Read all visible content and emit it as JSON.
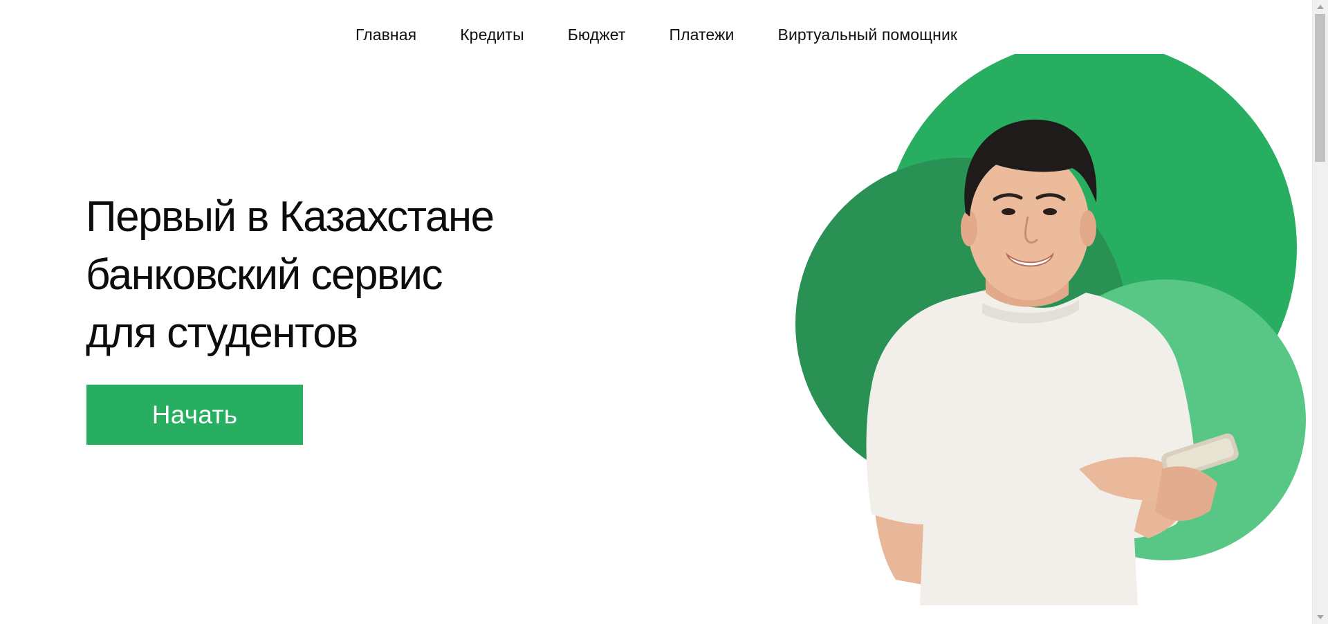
{
  "nav": {
    "items": [
      {
        "label": "Главная"
      },
      {
        "label": "Кредиты"
      },
      {
        "label": "Бюджет"
      },
      {
        "label": "Платежи"
      },
      {
        "label": "Виртуальный помощник"
      }
    ]
  },
  "hero": {
    "title_lines": [
      "Первый в Казахстане",
      "банковский сервис",
      "для студентов"
    ],
    "cta_label": "Начать"
  },
  "colors": {
    "brand_green": "#27ae60",
    "dark_green": "#2a9155",
    "light_green": "#58c785",
    "text": "#0c0c0c"
  },
  "icons": {
    "scroll_up": "scroll-up-arrow-icon",
    "scroll_down": "scroll-down-arrow-icon"
  }
}
